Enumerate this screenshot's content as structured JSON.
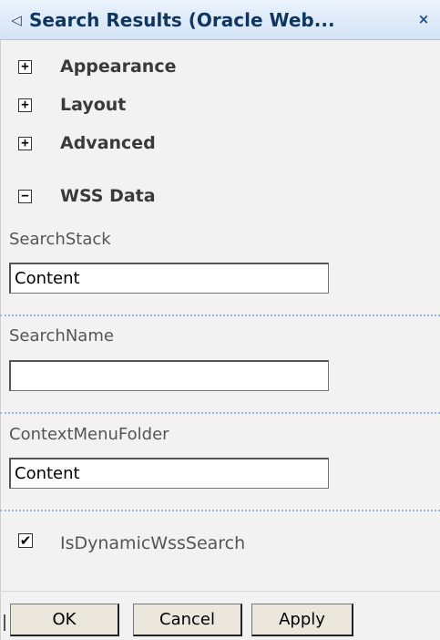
{
  "titlebar": {
    "arrow_glyph": "◁",
    "title": "Search Results (Oracle Web...",
    "close_glyph": "×"
  },
  "sections": [
    {
      "label": "Appearance",
      "toggle": "+"
    },
    {
      "label": "Layout",
      "toggle": "+"
    },
    {
      "label": "Advanced",
      "toggle": "+"
    },
    {
      "label": "WSS Data",
      "toggle": "−"
    }
  ],
  "fields": {
    "search_stack": {
      "label": "SearchStack",
      "value": "Content"
    },
    "search_name": {
      "label": "SearchName",
      "value": ""
    },
    "context_menu_folder": {
      "label": "ContextMenuFolder",
      "value": "Content"
    }
  },
  "is_dynamic": {
    "label": "IsDynamicWssSearch",
    "checked": true,
    "check_glyph": "✔"
  },
  "buttons": {
    "ok": "OK",
    "cancel": "Cancel",
    "apply": "Apply"
  },
  "colors": {
    "title_text": "#10355e",
    "panel_bg": "#f2f2f2",
    "dotted_separator": "#9bb5db",
    "button_bg": "#ebe7dc"
  }
}
